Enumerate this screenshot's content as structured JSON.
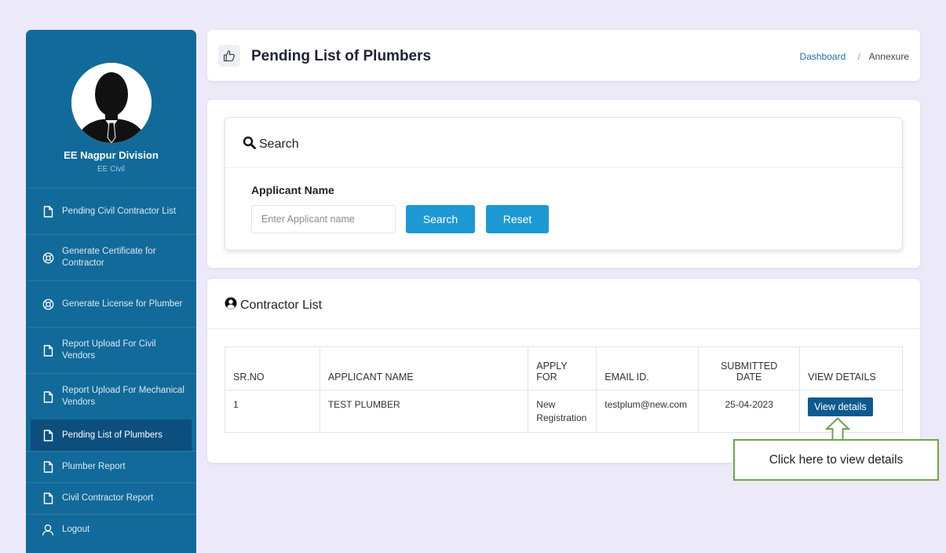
{
  "sidebar": {
    "user_name": "EE Nagpur Division",
    "user_role": "EE Civil",
    "items": [
      {
        "label": "Pending Civil Contractor List",
        "icon": "file-icon"
      },
      {
        "label": "Generate Certificate for Contractor",
        "icon": "lifebuoy-icon"
      },
      {
        "label": "Generate License for Plumber",
        "icon": "lifebuoy-icon"
      },
      {
        "label": "Report Upload For Civil Vendors",
        "icon": "file-icon"
      },
      {
        "label": "Report Upload For Mechanical Vendors",
        "icon": "file-icon"
      },
      {
        "label": "Pending List of Plumbers",
        "icon": "file-icon",
        "active": true
      },
      {
        "label": "Plumber Report",
        "icon": "file-icon"
      },
      {
        "label": "Civil Contractor Report",
        "icon": "file-icon"
      },
      {
        "label": "Logout",
        "icon": "user-icon"
      }
    ]
  },
  "header": {
    "title": "Pending List of Plumbers",
    "breadcrumb": {
      "link": "Dashboard",
      "separator": "/",
      "current": "Annexure"
    }
  },
  "search": {
    "title": "Search",
    "field_label": "Applicant Name",
    "placeholder": "Enter Applicant name",
    "value": "",
    "search_label": "Search",
    "reset_label": "Reset"
  },
  "contractor_list": {
    "title": "Contractor List",
    "columns": [
      "SR.NO",
      "APPLICANT NAME",
      "APPLY FOR",
      "EMAIL ID.",
      "SUBMITTED DATE",
      "VIEW DETAILS"
    ],
    "rows": [
      {
        "sr_no": "1",
        "name": "TEST PLUMBER",
        "apply_for": "New Registration",
        "email": "testplum@new.com",
        "date": "25-04-2023",
        "action": "View details"
      }
    ]
  },
  "callout": {
    "text": "Click here to view details"
  },
  "colors": {
    "sidebar": "#116a99",
    "active_item": "#0c4f7e",
    "button": "#1d99d3",
    "view_button": "#0d5a8f",
    "callout_border": "#6ea64b"
  }
}
